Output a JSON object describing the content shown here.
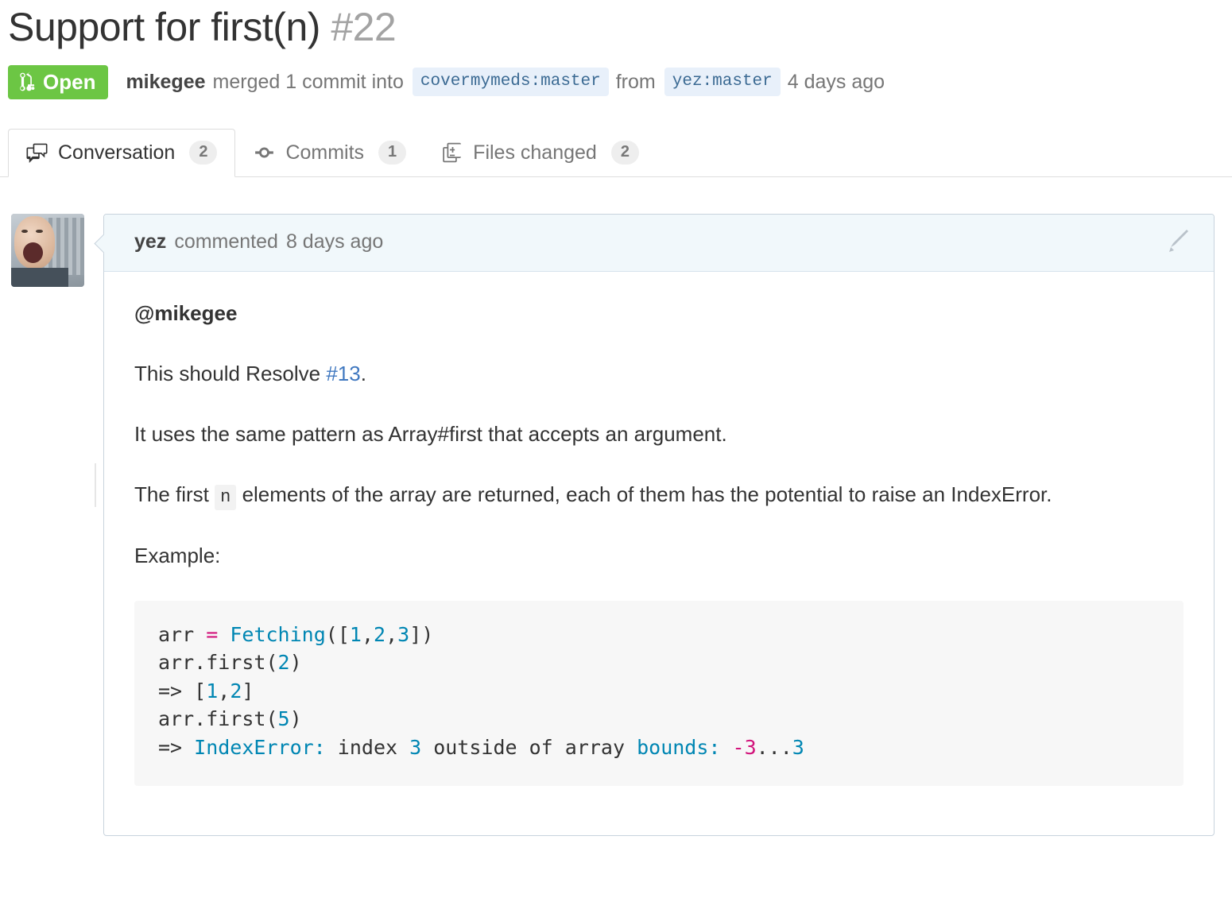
{
  "header": {
    "title": "Support for first(n)",
    "number": "#22",
    "state": "Open",
    "state_icon": "git-pull-request-icon",
    "state_color": "#6cc644",
    "author": "mikegee",
    "action_text": "merged 1 commit into",
    "base_branch": "covermymeds:master",
    "from_text": "from",
    "head_branch": "yez:master",
    "timestamp": "4 days ago"
  },
  "tabs": [
    {
      "label": "Conversation",
      "count": "2",
      "icon": "comment-discussion-icon",
      "selected": true
    },
    {
      "label": "Commits",
      "count": "1",
      "icon": "git-commit-icon",
      "selected": false
    },
    {
      "label": "Files changed",
      "count": "2",
      "icon": "file-diff-icon",
      "selected": false
    }
  ],
  "comment": {
    "avatar_name": "yez-avatar",
    "author": "yez",
    "action": "commented",
    "timestamp": "8 days ago",
    "edit_icon": "pencil-icon",
    "body": {
      "mention": "@mikegee",
      "line_resolve_pre": "This should Resolve ",
      "line_resolve_link": "#13",
      "line_resolve_post": ".",
      "paragraph_pattern": "It uses the same pattern as Array#first that accepts an argument.",
      "paragraph_first_pre": "The first ",
      "paragraph_first_code": "n",
      "paragraph_first_post": " elements of the array are returned, each of them has the potential to raise an IndexError.",
      "example_label": "Example:"
    },
    "code": {
      "lines": [
        [
          {
            "t": "arr ",
            "c": "tok-id"
          },
          {
            "t": "=",
            "c": "tok-kw"
          },
          {
            "t": " ",
            "c": "tok-id"
          },
          {
            "t": "Fetching",
            "c": "tok-cls"
          },
          {
            "t": "([",
            "c": "tok-id"
          },
          {
            "t": "1",
            "c": "tok-num"
          },
          {
            "t": ",",
            "c": "tok-id"
          },
          {
            "t": "2",
            "c": "tok-num"
          },
          {
            "t": ",",
            "c": "tok-id"
          },
          {
            "t": "3",
            "c": "tok-num"
          },
          {
            "t": "])",
            "c": "tok-id"
          }
        ],
        [
          {
            "t": "arr.first(",
            "c": "tok-id"
          },
          {
            "t": "2",
            "c": "tok-num"
          },
          {
            "t": ")",
            "c": "tok-id"
          }
        ],
        [
          {
            "t": "=> [",
            "c": "tok-id"
          },
          {
            "t": "1",
            "c": "tok-num"
          },
          {
            "t": ",",
            "c": "tok-id"
          },
          {
            "t": "2",
            "c": "tok-num"
          },
          {
            "t": "]",
            "c": "tok-id"
          }
        ],
        [
          {
            "t": "arr.first(",
            "c": "tok-id"
          },
          {
            "t": "5",
            "c": "tok-num"
          },
          {
            "t": ")",
            "c": "tok-id"
          }
        ],
        [
          {
            "t": "=> ",
            "c": "tok-id"
          },
          {
            "t": "IndexError:",
            "c": "tok-cls"
          },
          {
            "t": " index ",
            "c": "tok-id"
          },
          {
            "t": "3",
            "c": "tok-num"
          },
          {
            "t": " outside of array ",
            "c": "tok-id"
          },
          {
            "t": "bounds:",
            "c": "tok-cls"
          },
          {
            "t": " ",
            "c": "tok-id"
          },
          {
            "t": "-3",
            "c": "tok-kw"
          },
          {
            "t": "...",
            "c": "tok-id"
          },
          {
            "t": "3",
            "c": "tok-num"
          }
        ]
      ]
    }
  },
  "colors": {
    "open_green": "#6cc644",
    "link_blue": "#4078c0",
    "branch_chip_bg": "#e8f0fa",
    "branch_chip_text": "#3b6a93",
    "comment_header_bg": "#f1f8fb",
    "comment_border": "#c8d3dd",
    "code_bg": "#f7f7f7"
  }
}
